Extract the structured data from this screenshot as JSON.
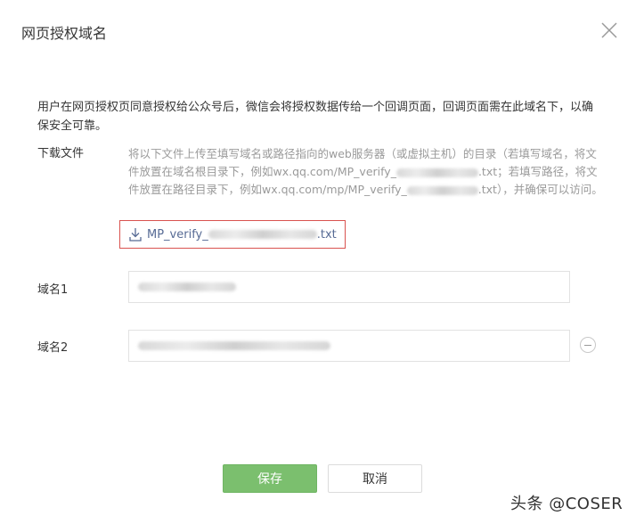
{
  "dialog": {
    "title": "网页授权域名",
    "description": "用户在网页授权页同意授权给公众号后，微信会将授权数据传给一个回调页面，回调页面需在此域名下，以确保安全可靠。"
  },
  "download": {
    "label": "下载文件",
    "hint_part1": "将以下文件上传至填写域名或路径指向的web服务器（或虚拟主机）的目录（若填写域名，将文件放置在域名根目录下，例如wx.qq.com/MP_verify_",
    "hint_part2": ".txt；若填写路径，将文件放置在路径目录下，例如wx.qq.com/mp/MP_verify_",
    "hint_part3": ".txt），并确保可以访问。",
    "file_prefix": "MP_verify_",
    "file_suffix": ".txt"
  },
  "domains": {
    "label1": "域名1",
    "label2": "域名2"
  },
  "buttons": {
    "save": "保存",
    "cancel": "取消"
  },
  "watermark": "头条 @COSER",
  "colors": {
    "primary_green": "#7bbf6e",
    "link_blue": "#576b95",
    "highlight_border": "#d9534f"
  }
}
